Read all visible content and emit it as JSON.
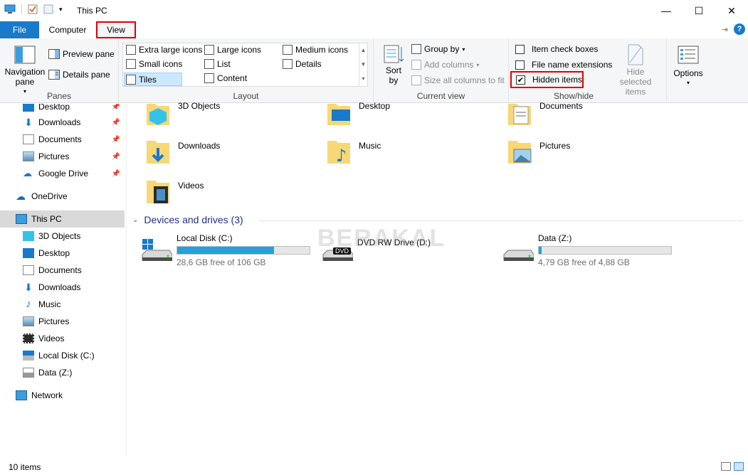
{
  "window": {
    "title": "This PC",
    "controls": {
      "minimize": "—",
      "maximize": "☐",
      "close": "✕"
    }
  },
  "tabs": [
    {
      "label": "File"
    },
    {
      "label": "Computer"
    },
    {
      "label": "View"
    }
  ],
  "ribbon": {
    "panes": {
      "label": "Panes",
      "navigation_pane": "Navigation pane",
      "preview_pane": "Preview pane",
      "details_pane": "Details pane"
    },
    "layout": {
      "label": "Layout",
      "options": [
        "Extra large icons",
        "Large icons",
        "Medium icons",
        "Small icons",
        "List",
        "Details",
        "Tiles",
        "Content"
      ],
      "selected": "Tiles"
    },
    "current_view": {
      "label": "Current view",
      "sort_by": "Sort by",
      "group_by": "Group by",
      "add_columns": "Add columns",
      "size_columns": "Size all columns to fit"
    },
    "show_hide": {
      "label": "Show/hide",
      "item_check_boxes": "Item check boxes",
      "file_name_extensions": "File name extensions",
      "hidden_items": "Hidden items",
      "hide_selected": "Hide selected items"
    },
    "options": {
      "label": "Options"
    }
  },
  "nav": {
    "quick_access": [
      {
        "label": "Desktop"
      },
      {
        "label": "Downloads"
      },
      {
        "label": "Documents"
      },
      {
        "label": "Pictures"
      },
      {
        "label": "Google Drive"
      }
    ],
    "onedrive": "OneDrive",
    "this_pc": "This PC",
    "this_pc_items": [
      {
        "label": "3D Objects"
      },
      {
        "label": "Desktop"
      },
      {
        "label": "Documents"
      },
      {
        "label": "Downloads"
      },
      {
        "label": "Music"
      },
      {
        "label": "Pictures"
      },
      {
        "label": "Videos"
      },
      {
        "label": "Local Disk (C:)"
      },
      {
        "label": "Data (Z:)"
      }
    ],
    "network": "Network"
  },
  "folders": [
    {
      "name": "3D Objects"
    },
    {
      "name": "Desktop"
    },
    {
      "name": "Documents"
    },
    {
      "name": "Downloads"
    },
    {
      "name": "Music"
    },
    {
      "name": "Pictures"
    },
    {
      "name": "Videos"
    }
  ],
  "drives_section": {
    "title": "Devices and drives (3)"
  },
  "drives": [
    {
      "name": "Local Disk (C:)",
      "free": "28,6 GB free of 106 GB",
      "used_fraction": 0.73
    },
    {
      "name": "DVD RW Drive (D:)",
      "badge": "DVD"
    },
    {
      "name": "Data (Z:)",
      "free": "4,79 GB free of 4,88 GB",
      "used_fraction": 0.02
    }
  ],
  "watermark": "BERAKAL",
  "status": {
    "items": "10 items"
  },
  "colors": {
    "accent": "#1979ca",
    "highlight": "#e00000",
    "bar": "#26a0da",
    "header": "#1e3287"
  }
}
